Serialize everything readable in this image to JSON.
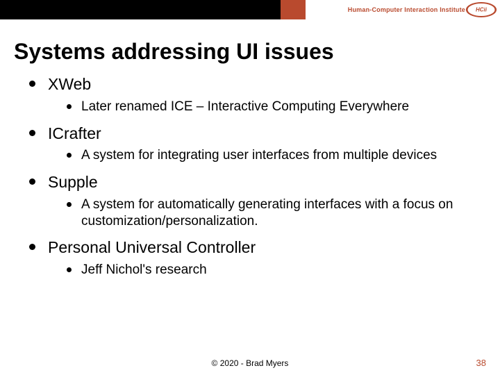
{
  "header": {
    "institute_label": "Human-Computer Interaction Institute",
    "logo_text": "HCii"
  },
  "title": "Systems addressing UI issues",
  "bullets": [
    {
      "label": "XWeb",
      "sub": [
        "Later renamed ICE – Interactive Computing Everywhere"
      ]
    },
    {
      "label": "ICrafter",
      "sub": [
        "A system for integrating user interfaces from multiple devices"
      ]
    },
    {
      "label": "Supple",
      "sub": [
        "A system for automatically generating interfaces with a focus on customization/personalization."
      ]
    },
    {
      "label": "Personal Universal Controller",
      "sub": [
        "Jeff Nichol's research"
      ]
    }
  ],
  "footer": {
    "copyright": "© 2020 - Brad Myers",
    "pagenum": "38"
  }
}
